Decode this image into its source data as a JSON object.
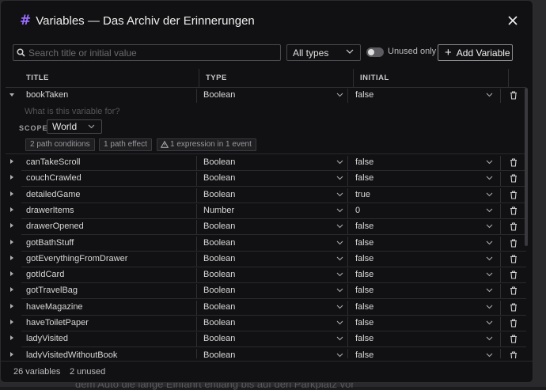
{
  "dialog": {
    "title": "Variables — Das Archiv der Erinnerungen"
  },
  "toolbar": {
    "search_placeholder": "Search title or initial value",
    "search_value": "",
    "type_filter": "All types",
    "unused_only_label": "Unused only",
    "unused_only_on": false,
    "add_label": "Add Variable"
  },
  "table": {
    "headers": [
      "TITLE",
      "TYPE",
      "INITIAL"
    ],
    "expanded": {
      "title": "bookTaken",
      "type": "Boolean",
      "initial": "false",
      "description_placeholder": "What is this variable for?",
      "scope_label": "SCOPE",
      "scope_value": "World",
      "chips": [
        "2 path conditions",
        "1 path effect",
        "1 expression in 1 event"
      ]
    },
    "rows": [
      {
        "title": "canTakeScroll",
        "type": "Boolean",
        "initial": "false"
      },
      {
        "title": "couchCrawled",
        "type": "Boolean",
        "initial": "false"
      },
      {
        "title": "detailedGame",
        "type": "Boolean",
        "initial": "true"
      },
      {
        "title": "drawerItems",
        "type": "Number",
        "initial": "0"
      },
      {
        "title": "drawerOpened",
        "type": "Boolean",
        "initial": "false"
      },
      {
        "title": "gotBathStuff",
        "type": "Boolean",
        "initial": "false"
      },
      {
        "title": "gotEverythingFromDrawer",
        "type": "Boolean",
        "initial": "false"
      },
      {
        "title": "gotIdCard",
        "type": "Boolean",
        "initial": "false"
      },
      {
        "title": "gotTravelBag",
        "type": "Boolean",
        "initial": "false"
      },
      {
        "title": "haveMagazine",
        "type": "Boolean",
        "initial": "false"
      },
      {
        "title": "haveToiletPaper",
        "type": "Boolean",
        "initial": "false"
      },
      {
        "title": "ladyVisited",
        "type": "Boolean",
        "initial": "false"
      },
      {
        "title": "ladyVisitedWithoutBook",
        "type": "Boolean",
        "initial": "false"
      }
    ]
  },
  "footer": {
    "count": "26 variables",
    "unused": "2 unused"
  },
  "background": {
    "text": "dem Auto die lange Einfahrt entlang bis auf den Parkplatz vor"
  },
  "colors": {
    "accent": "#9a6cff",
    "dialog_bg": "#111113",
    "border": "#2f2f33"
  }
}
